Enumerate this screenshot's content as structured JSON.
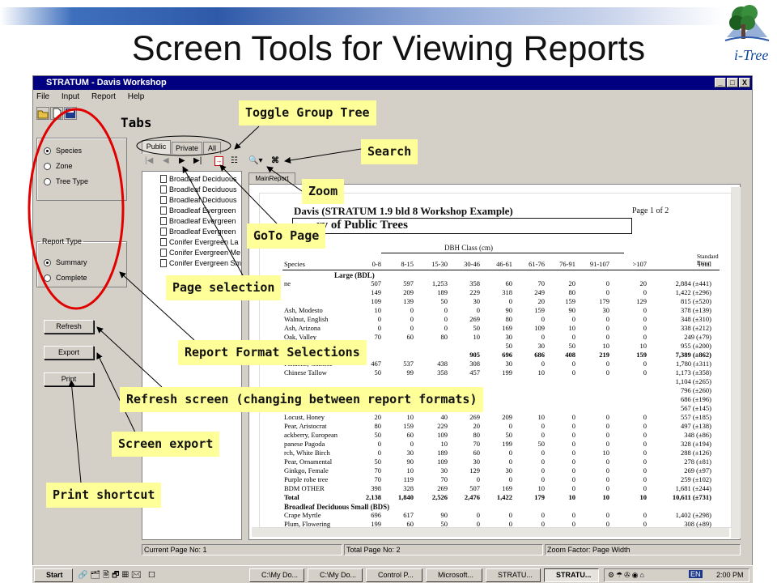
{
  "slide": {
    "title": "Screen Tools for Viewing Reports",
    "logo_text": "i-Tree"
  },
  "window": {
    "title": "STRATUM - Davis Workshop",
    "menu": [
      "File",
      "Input",
      "Report",
      "Help"
    ],
    "controls": [
      "_",
      "□",
      "X"
    ]
  },
  "left_panel": {
    "group_by": {
      "options": [
        "Species",
        "Zone",
        "Tree Type"
      ],
      "selected": "Species"
    },
    "report_type": {
      "legend": "Report Type",
      "options": [
        "Summary",
        "Complete"
      ],
      "selected": "Summary"
    },
    "buttons": {
      "refresh": "Refresh",
      "export": "Export",
      "print": "Print"
    }
  },
  "tabs": [
    "Public",
    "Private",
    "All"
  ],
  "active_tab": "Public",
  "tree_items": [
    "Broadleaf Deciduous",
    "Broadleaf Deciduous",
    "Broadleaf Deciduous",
    "Broadleaf Evergreen",
    "Broadleaf Evergreen",
    "Broadleaf Evergreen",
    "Conifer Evergreen La",
    "Conifer Evergreen Me",
    "Conifer Evergreen Sm"
  ],
  "report_tab": "MainReport",
  "report": {
    "header": "Davis (STRATUM 1.9 bld 8 Workshop Example)",
    "page_of": "Page 1 of 2",
    "subtitle_visible": "ry of Public Trees",
    "dbh_label": "DBH Class (cm)",
    "columns": [
      "Species",
      "0-8",
      "8-15",
      "15-30",
      "30-46",
      "46-61",
      "61-76",
      "76-91",
      "91-107",
      ">107",
      "Total",
      "Standard Error"
    ],
    "section1": "Large (BDL)",
    "rows": [
      {
        "species": "ne",
        "values": [
          "507",
          "597",
          "1,253",
          "358",
          "60",
          "70",
          "20",
          "0",
          "20",
          "2,884 (±441)"
        ]
      },
      {
        "species": "",
        "values": [
          "149",
          "209",
          "189",
          "229",
          "318",
          "249",
          "80",
          "0",
          "0",
          "1,422 (±296)"
        ]
      },
      {
        "species": "",
        "values": [
          "109",
          "139",
          "50",
          "30",
          "0",
          "20",
          "159",
          "179",
          "129",
          "815 (±520)"
        ]
      },
      {
        "species": "Ash, Modesto",
        "values": [
          "10",
          "0",
          "0",
          "0",
          "90",
          "159",
          "90",
          "30",
          "0",
          "378 (±139)"
        ]
      },
      {
        "species": "Walnut, English",
        "values": [
          "0",
          "0",
          "0",
          "269",
          "80",
          "0",
          "0",
          "0",
          "0",
          "348 (±310)"
        ]
      },
      {
        "species": "Ash, Arizona",
        "values": [
          "0",
          "0",
          "0",
          "50",
          "169",
          "109",
          "10",
          "0",
          "0",
          "338 (±212)"
        ]
      },
      {
        "species": "Oak, Valley",
        "values": [
          "70",
          "60",
          "80",
          "10",
          "30",
          "0",
          "0",
          "0",
          "0",
          "249 (±79)"
        ]
      },
      {
        "species": "",
        "values": [
          "",
          "",
          "",
          "",
          "50",
          "30",
          "50",
          "10",
          "10",
          "955 (±200)"
        ]
      },
      {
        "species": "",
        "values": [
          "",
          "",
          "",
          "905",
          "696",
          "686",
          "408",
          "219",
          "159",
          "7,389 (±862)"
        ],
        "bold": true
      },
      {
        "species": "Pistache, Chinese",
        "values": [
          "467",
          "537",
          "438",
          "308",
          "30",
          "0",
          "0",
          "0",
          "0",
          "1,780 (±311)"
        ]
      },
      {
        "species": "Chinese Tallow",
        "values": [
          "50",
          "99",
          "358",
          "457",
          "199",
          "10",
          "0",
          "0",
          "0",
          "1,173 (±358)"
        ]
      },
      {
        "species": "",
        "values": [
          "",
          "",
          "",
          "",
          "",
          "",
          "",
          "",
          "",
          "1,104 (±265)"
        ]
      },
      {
        "species": "",
        "values": [
          "",
          "",
          "",
          "",
          "",
          "",
          "",
          "",
          "",
          "796 (±260)"
        ]
      },
      {
        "species": "",
        "values": [
          "",
          "",
          "",
          "",
          "",
          "",
          "",
          "",
          "",
          "686 (±196)"
        ]
      },
      {
        "species": "",
        "values": [
          "",
          "",
          "",
          "",
          "",
          "",
          "",
          "",
          "",
          "567 (±145)"
        ]
      },
      {
        "species": "Locust, Honey",
        "values": [
          "20",
          "10",
          "40",
          "269",
          "209",
          "10",
          "0",
          "0",
          "0",
          "557 (±185)"
        ]
      },
      {
        "species": "Pear, Aristocrat",
        "values": [
          "80",
          "159",
          "229",
          "20",
          "0",
          "0",
          "0",
          "0",
          "0",
          "497 (±138)"
        ]
      },
      {
        "species": "ackberry, European",
        "values": [
          "50",
          "60",
          "109",
          "80",
          "50",
          "0",
          "0",
          "0",
          "0",
          "348 (±86)"
        ]
      },
      {
        "species": "panese Pagoda",
        "values": [
          "0",
          "0",
          "10",
          "70",
          "199",
          "50",
          "0",
          "0",
          "0",
          "328 (±194)"
        ]
      },
      {
        "species": "rch, White Birch",
        "values": [
          "0",
          "30",
          "189",
          "60",
          "0",
          "0",
          "0",
          "10",
          "0",
          "288 (±126)"
        ]
      },
      {
        "species": "Pear, Ornamental",
        "values": [
          "50",
          "90",
          "109",
          "30",
          "0",
          "0",
          "0",
          "0",
          "0",
          "278 (±81)"
        ]
      },
      {
        "species": "Ginkgo, Female",
        "values": [
          "70",
          "10",
          "30",
          "129",
          "30",
          "0",
          "0",
          "0",
          "0",
          "269 (±97)"
        ]
      },
      {
        "species": "Purple robe tree",
        "values": [
          "70",
          "119",
          "70",
          "0",
          "0",
          "0",
          "0",
          "0",
          "0",
          "259 (±102)"
        ]
      },
      {
        "species": "BDM OTHER",
        "values": [
          "398",
          "328",
          "269",
          "507",
          "169",
          "10",
          "0",
          "0",
          "0",
          "1,681 (±244)"
        ]
      },
      {
        "species": "Total",
        "values": [
          "2,138",
          "1,840",
          "2,526",
          "2,476",
          "1,422",
          "179",
          "10",
          "10",
          "10",
          "10,611 (±731)"
        ],
        "bold": true
      }
    ],
    "section2": "Broadleaf Deciduous Small (BDS)",
    "rows2": [
      {
        "species": "Crape Myrtle",
        "values": [
          "696",
          "617",
          "90",
          "0",
          "0",
          "0",
          "0",
          "0",
          "0",
          "1,402 (±298)"
        ]
      },
      {
        "species": "Plum, Flowering",
        "values": [
          "199",
          "60",
          "50",
          "0",
          "0",
          "0",
          "0",
          "0",
          "0",
          "308 (±89)"
        ]
      }
    ]
  },
  "status": {
    "current_page": "Current Page No: 1",
    "total_page": "Total Page No: 2",
    "zoom": "Zoom Factor: Page Width"
  },
  "taskbar": {
    "start": "Start",
    "tasks": [
      "C:\\My Do...",
      "C:\\My Do...",
      "Control P...",
      "Microsoft...",
      "STRATU...",
      "STRATU..."
    ],
    "clock": "2:00 PM",
    "lang": "EN"
  },
  "callouts": {
    "tabs": "Tabs",
    "toggle_group_tree": "Toggle Group Tree",
    "search": "Search",
    "zoom": "Zoom",
    "goto_page": "GoTo Page",
    "page_selection": "Page selection",
    "report_format": "Report Format Selections",
    "refresh": "Refresh screen (changing between report formats)",
    "export": "Screen export",
    "print": "Print shortcut"
  }
}
